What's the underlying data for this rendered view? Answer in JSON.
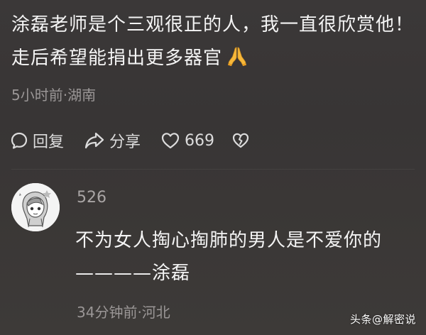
{
  "comment": {
    "text": "涂磊老师是个三观很正的人，我一直很欣赏他！走后希望能捐出更多器官",
    "emoji": "folded-hands",
    "meta": "5小时前·湖南"
  },
  "actions": {
    "reply_label": "回复",
    "share_label": "分享",
    "like_count": "669"
  },
  "reply": {
    "username": "526",
    "text": "不为女人掏心掏肺的男人是不爱你的————涂磊",
    "meta": "34分钟前·河北"
  },
  "watermark": {
    "text": "头条@解密说"
  },
  "colors": {
    "background": "#393636",
    "text_primary": "#f4f4f4",
    "text_secondary": "#9a9696",
    "emoji_yellow": "#f7b83a"
  }
}
